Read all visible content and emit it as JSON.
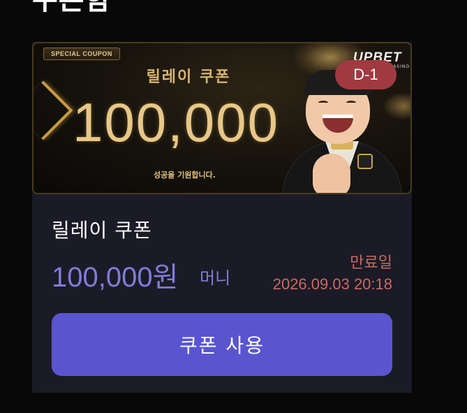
{
  "page": {
    "title": "쿠폰함"
  },
  "banner": {
    "tag": "SPECIAL COUPON",
    "subtitle": "릴레이 쿠폰",
    "amount": "100,000",
    "wish": "성공을 기원합니다.",
    "brand": "UPBET",
    "brand_sub": "PREMIUM CASINO",
    "dday": "D-1"
  },
  "coupon": {
    "name": "릴레이 쿠폰",
    "amount": "100,000원",
    "unit": "머니",
    "expire_label": "만료일",
    "expire_date": "2026.09.03 20:18",
    "use_button_label": "쿠폰 사용"
  },
  "colors": {
    "accent": "#5a55cf",
    "amount": "#7f7cd8",
    "expire": "#c76a62",
    "dday_badge": "#a03a40",
    "gold": "#e8c888"
  }
}
